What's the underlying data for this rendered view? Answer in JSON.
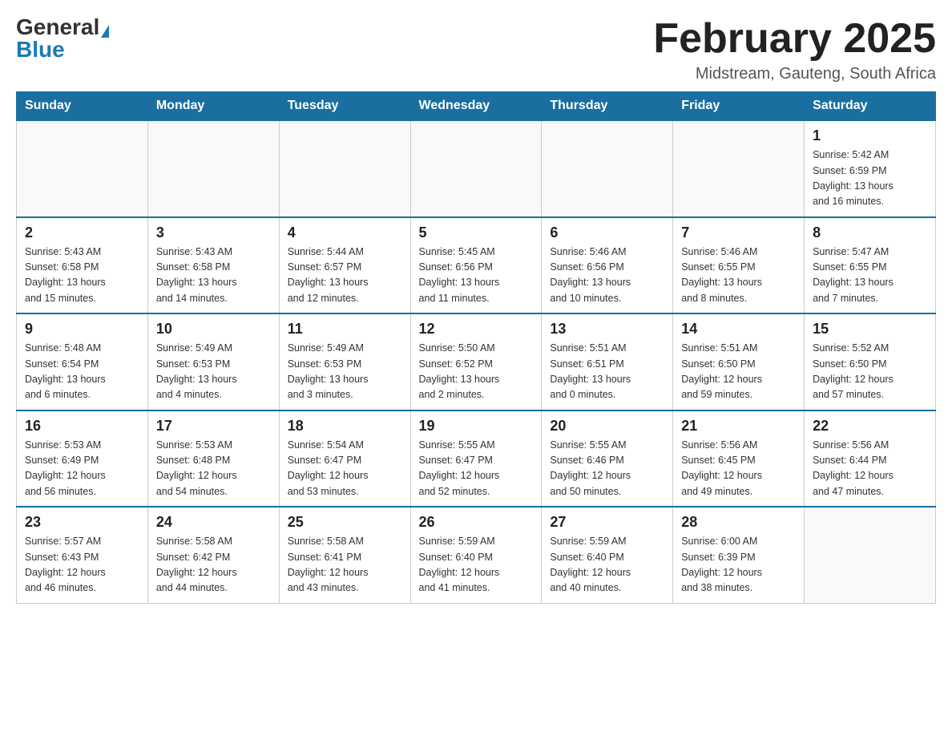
{
  "logo": {
    "general": "General",
    "blue": "Blue"
  },
  "header": {
    "title": "February 2025",
    "location": "Midstream, Gauteng, South Africa"
  },
  "weekdays": [
    "Sunday",
    "Monday",
    "Tuesday",
    "Wednesday",
    "Thursday",
    "Friday",
    "Saturday"
  ],
  "weeks": [
    [
      {
        "day": "",
        "info": ""
      },
      {
        "day": "",
        "info": ""
      },
      {
        "day": "",
        "info": ""
      },
      {
        "day": "",
        "info": ""
      },
      {
        "day": "",
        "info": ""
      },
      {
        "day": "",
        "info": ""
      },
      {
        "day": "1",
        "info": "Sunrise: 5:42 AM\nSunset: 6:59 PM\nDaylight: 13 hours\nand 16 minutes."
      }
    ],
    [
      {
        "day": "2",
        "info": "Sunrise: 5:43 AM\nSunset: 6:58 PM\nDaylight: 13 hours\nand 15 minutes."
      },
      {
        "day": "3",
        "info": "Sunrise: 5:43 AM\nSunset: 6:58 PM\nDaylight: 13 hours\nand 14 minutes."
      },
      {
        "day": "4",
        "info": "Sunrise: 5:44 AM\nSunset: 6:57 PM\nDaylight: 13 hours\nand 12 minutes."
      },
      {
        "day": "5",
        "info": "Sunrise: 5:45 AM\nSunset: 6:56 PM\nDaylight: 13 hours\nand 11 minutes."
      },
      {
        "day": "6",
        "info": "Sunrise: 5:46 AM\nSunset: 6:56 PM\nDaylight: 13 hours\nand 10 minutes."
      },
      {
        "day": "7",
        "info": "Sunrise: 5:46 AM\nSunset: 6:55 PM\nDaylight: 13 hours\nand 8 minutes."
      },
      {
        "day": "8",
        "info": "Sunrise: 5:47 AM\nSunset: 6:55 PM\nDaylight: 13 hours\nand 7 minutes."
      }
    ],
    [
      {
        "day": "9",
        "info": "Sunrise: 5:48 AM\nSunset: 6:54 PM\nDaylight: 13 hours\nand 6 minutes."
      },
      {
        "day": "10",
        "info": "Sunrise: 5:49 AM\nSunset: 6:53 PM\nDaylight: 13 hours\nand 4 minutes."
      },
      {
        "day": "11",
        "info": "Sunrise: 5:49 AM\nSunset: 6:53 PM\nDaylight: 13 hours\nand 3 minutes."
      },
      {
        "day": "12",
        "info": "Sunrise: 5:50 AM\nSunset: 6:52 PM\nDaylight: 13 hours\nand 2 minutes."
      },
      {
        "day": "13",
        "info": "Sunrise: 5:51 AM\nSunset: 6:51 PM\nDaylight: 13 hours\nand 0 minutes."
      },
      {
        "day": "14",
        "info": "Sunrise: 5:51 AM\nSunset: 6:50 PM\nDaylight: 12 hours\nand 59 minutes."
      },
      {
        "day": "15",
        "info": "Sunrise: 5:52 AM\nSunset: 6:50 PM\nDaylight: 12 hours\nand 57 minutes."
      }
    ],
    [
      {
        "day": "16",
        "info": "Sunrise: 5:53 AM\nSunset: 6:49 PM\nDaylight: 12 hours\nand 56 minutes."
      },
      {
        "day": "17",
        "info": "Sunrise: 5:53 AM\nSunset: 6:48 PM\nDaylight: 12 hours\nand 54 minutes."
      },
      {
        "day": "18",
        "info": "Sunrise: 5:54 AM\nSunset: 6:47 PM\nDaylight: 12 hours\nand 53 minutes."
      },
      {
        "day": "19",
        "info": "Sunrise: 5:55 AM\nSunset: 6:47 PM\nDaylight: 12 hours\nand 52 minutes."
      },
      {
        "day": "20",
        "info": "Sunrise: 5:55 AM\nSunset: 6:46 PM\nDaylight: 12 hours\nand 50 minutes."
      },
      {
        "day": "21",
        "info": "Sunrise: 5:56 AM\nSunset: 6:45 PM\nDaylight: 12 hours\nand 49 minutes."
      },
      {
        "day": "22",
        "info": "Sunrise: 5:56 AM\nSunset: 6:44 PM\nDaylight: 12 hours\nand 47 minutes."
      }
    ],
    [
      {
        "day": "23",
        "info": "Sunrise: 5:57 AM\nSunset: 6:43 PM\nDaylight: 12 hours\nand 46 minutes."
      },
      {
        "day": "24",
        "info": "Sunrise: 5:58 AM\nSunset: 6:42 PM\nDaylight: 12 hours\nand 44 minutes."
      },
      {
        "day": "25",
        "info": "Sunrise: 5:58 AM\nSunset: 6:41 PM\nDaylight: 12 hours\nand 43 minutes."
      },
      {
        "day": "26",
        "info": "Sunrise: 5:59 AM\nSunset: 6:40 PM\nDaylight: 12 hours\nand 41 minutes."
      },
      {
        "day": "27",
        "info": "Sunrise: 5:59 AM\nSunset: 6:40 PM\nDaylight: 12 hours\nand 40 minutes."
      },
      {
        "day": "28",
        "info": "Sunrise: 6:00 AM\nSunset: 6:39 PM\nDaylight: 12 hours\nand 38 minutes."
      },
      {
        "day": "",
        "info": ""
      }
    ]
  ]
}
